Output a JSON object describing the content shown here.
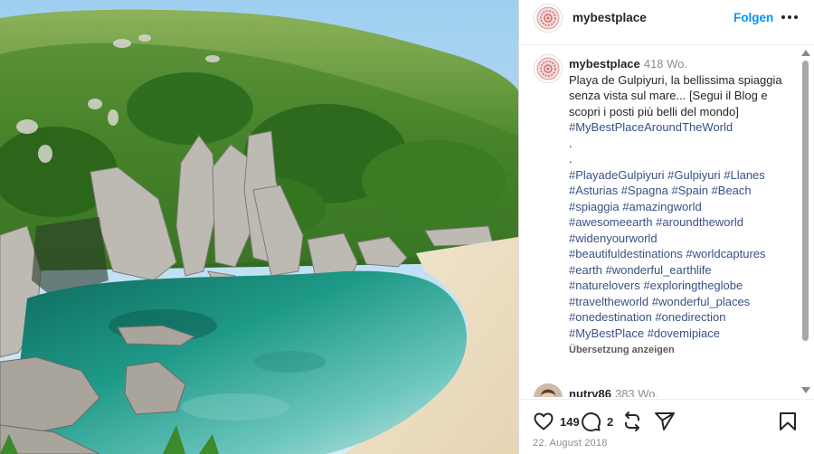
{
  "header": {
    "username": "mybestplace",
    "follow_label": "Folgen",
    "more_icon": "more-horizontal-icon"
  },
  "photo": {
    "description_icon": "post-image"
  },
  "caption": {
    "username": "mybestplace",
    "age": "418 Wo.",
    "text": "Playa de Gulpiyuri, la bellissima spiaggia senza vista sul mare... [Segui il Blog e scopri i posti più belli del mondo]",
    "lines": [
      "#MyBestPlaceAroundTheWorld",
      ".",
      ".",
      "#PlayadeGulpiyuri #Gulpiyuri #Llanes",
      "#Asturias #Spagna #Spain #Beach",
      "#spiaggia #amazingworld",
      "#awesomeearth #aroundtheworld",
      "#widenyourworld",
      "#beautifuldestinations #worldcaptures",
      "#earth #wonderful_earthlife",
      "#naturelovers #exploringtheglobe",
      "#traveltheworld #wonderful_places",
      "#onedestination #onedirection",
      "#MyBestPlace #dovemipiace"
    ],
    "translate_label": "Übersetzung anzeigen"
  },
  "comment": {
    "username": "nutrv86",
    "age": "383 Wo."
  },
  "actions": {
    "likes": "149",
    "comments": "2",
    "like_icon": "heart-icon",
    "comment_icon": "comment-bubble-icon",
    "share_icon": "repost-icon",
    "send_icon": "send-icon",
    "save_icon": "bookmark-icon"
  },
  "post_date": "22. August 2018",
  "colors": {
    "accent": "#0095f6",
    "hashtag": "#385185",
    "muted": "#8e8e8e"
  }
}
